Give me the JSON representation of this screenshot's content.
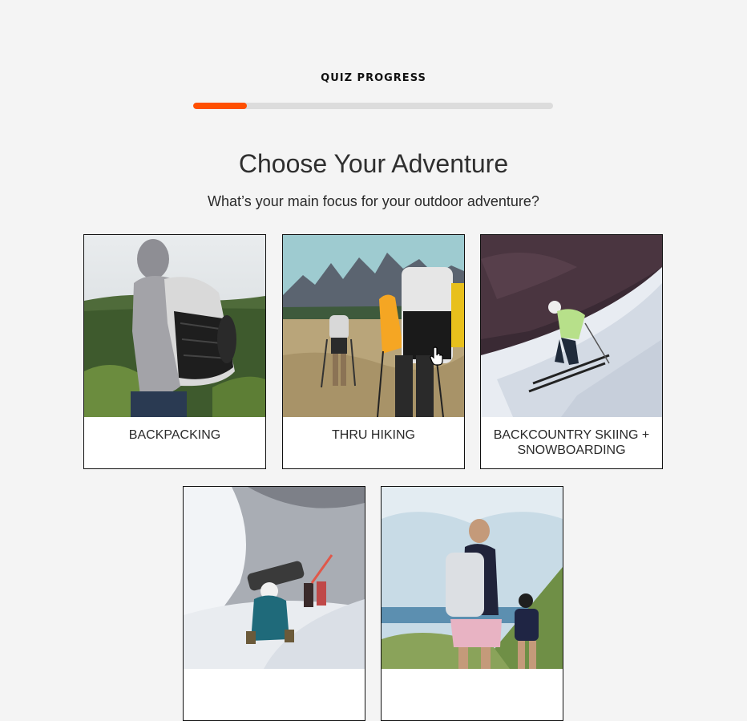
{
  "progress": {
    "label": "QUIZ PROGRESS",
    "value_percent": 15,
    "accent_color": "#ff4f00",
    "track_color": "#dcdcdc"
  },
  "header": {
    "title": "Choose Your Adventure",
    "subtitle": "What’s your main focus for your outdoor adventure?"
  },
  "options": [
    {
      "label": "BACKPACKING",
      "image_icon": "backpacker-photo"
    },
    {
      "label": "THRU HIKING",
      "image_icon": "thru-hikers-photo"
    },
    {
      "label": "BACKCOUNTRY SKIING + SNOWBOARDING",
      "image_icon": "skier-photo"
    },
    {
      "label": "",
      "image_icon": "mountaineer-photo"
    },
    {
      "label": "",
      "image_icon": "family-hike-photo"
    }
  ]
}
